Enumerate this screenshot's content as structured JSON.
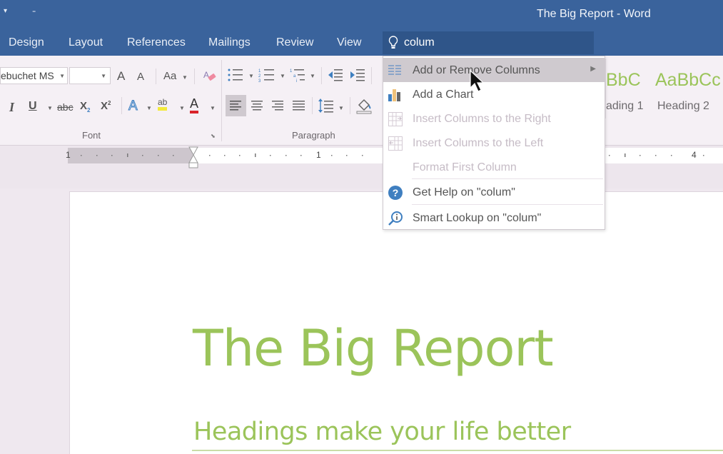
{
  "window": {
    "title": "The Big Report - Word"
  },
  "qat": {
    "customize_glyph": "▾",
    "more_glyph": "₌"
  },
  "tabs": [
    {
      "label": "Design"
    },
    {
      "label": "Layout"
    },
    {
      "label": "References"
    },
    {
      "label": "Mailings"
    },
    {
      "label": "Review"
    },
    {
      "label": "View"
    }
  ],
  "tell_me": {
    "value": "colum",
    "icon": "lightbulb-icon"
  },
  "ribbon": {
    "font": {
      "name": "ebuchet MS",
      "size": "",
      "group_label": "Font",
      "grow": "A",
      "shrink": "A",
      "change_case": "Aa",
      "italic": "I",
      "underline": "U",
      "strikethrough": "abc",
      "subscript": "X",
      "superscript": "X",
      "text_effects": "A",
      "highlight": "ab",
      "font_color": "A",
      "font_color_value": "#d9232a",
      "highlight_color_value": "#f3ea3a"
    },
    "paragraph": {
      "group_label": "Paragraph"
    },
    "styles": [
      {
        "preview": "BbC",
        "name": "ading 1"
      },
      {
        "preview": "AaBbCc",
        "name": "Heading 2"
      }
    ]
  },
  "ruler": {
    "labels": [
      "1",
      "1",
      "4"
    ]
  },
  "menu": {
    "items": [
      {
        "label": "Add or Remove Columns",
        "icon": "columns-icon",
        "state": "highlighted",
        "submenu": true
      },
      {
        "label": "Add a Chart",
        "icon": "chart-icon",
        "state": "enabled"
      },
      {
        "label": "Insert Columns to the Right",
        "icon": "insert-columns-right-icon",
        "state": "disabled"
      },
      {
        "label": "Insert Columns to the Left",
        "icon": "insert-columns-left-icon",
        "state": "disabled"
      },
      {
        "label": "Format First Column",
        "icon": "",
        "state": "disabled"
      },
      {
        "label": "Get Help on \"colum\"",
        "icon": "help-icon",
        "state": "enabled"
      },
      {
        "label": "Smart Lookup on \"colum\"",
        "icon": "smart-lookup-icon",
        "state": "enabled"
      }
    ]
  },
  "document": {
    "title": "The Big Report",
    "heading1": "Headings make your life better"
  },
  "colors": {
    "titlebar": "#3a639c",
    "accent_green": "#9bc45a",
    "help_blue": "#3f7fc0"
  }
}
